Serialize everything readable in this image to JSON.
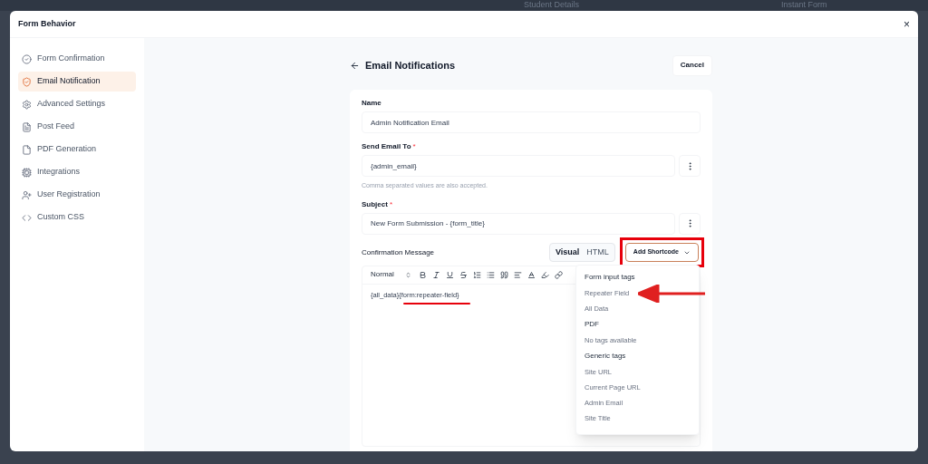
{
  "background": {
    "title": "Student Details",
    "action": "Instant Form"
  },
  "modal": {
    "title": "Form Behavior",
    "close": "×"
  },
  "sidebar": {
    "items": [
      {
        "label": "Form Confirmation",
        "selected": false
      },
      {
        "label": "Email Notification",
        "selected": true
      },
      {
        "label": "Advanced Settings",
        "selected": false
      },
      {
        "label": "Post Feed",
        "selected": false
      },
      {
        "label": "PDF Generation",
        "selected": false
      },
      {
        "label": "Integrations",
        "selected": false
      },
      {
        "label": "User Registration",
        "selected": false
      },
      {
        "label": "Custom CSS",
        "selected": false
      }
    ]
  },
  "header": {
    "title": "Email Notifications",
    "cancel": "Cancel"
  },
  "fields": [
    {
      "label": "Name",
      "value": "Admin Notification Email",
      "has_menu": false
    },
    {
      "label": "Send Email To",
      "required_mark": "*",
      "value": "{admin_email}",
      "has_menu": true,
      "hint": "Comma separated values are also accepted."
    },
    {
      "label": "Subject",
      "required_mark": "*",
      "value": "New Form Submission - {form_title}",
      "has_menu": true
    }
  ],
  "message": {
    "label": "Confirmation Message",
    "modes": [
      {
        "label": "Visual",
        "selected": true
      },
      {
        "label": "HTML",
        "selected": false
      }
    ],
    "shortcode_button": "Add Shortcode",
    "format": "Normal",
    "content": "{all_data}{form:repeater-field}"
  },
  "dropdown": {
    "items": [
      {
        "kind": "heading",
        "label": "Form input tags"
      },
      {
        "kind": "option",
        "label": "Repeater Field"
      },
      {
        "kind": "option",
        "label": "All Data"
      },
      {
        "kind": "heading",
        "label": "PDF"
      },
      {
        "kind": "option",
        "label": "No tags available"
      },
      {
        "kind": "heading",
        "label": "Generic tags"
      },
      {
        "kind": "option",
        "label": "Site URL"
      },
      {
        "kind": "option",
        "label": "Current Page URL"
      },
      {
        "kind": "option",
        "label": "Admin Email"
      },
      {
        "kind": "option",
        "label": "Site Title"
      }
    ]
  }
}
